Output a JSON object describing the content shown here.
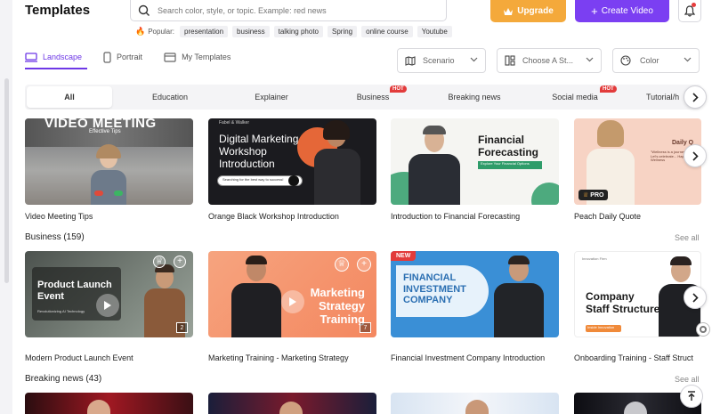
{
  "header": {
    "title": "Templates",
    "search_placeholder": "Search color, style, or topic. Example: red news",
    "popular_label": "Popular:",
    "popular_tags": [
      "presentation",
      "business",
      "talking photo",
      "Spring",
      "online course",
      "Youtube"
    ],
    "upgrade_label": "Upgrade",
    "create_label": "Create Video"
  },
  "orientation_tabs": [
    {
      "label": "Landscape",
      "icon": "monitor-icon",
      "active": true
    },
    {
      "label": "Portrait",
      "icon": "phone-icon",
      "active": false
    },
    {
      "label": "My Templates",
      "icon": "folder-icon",
      "active": false
    }
  ],
  "filters": {
    "scenario": "Scenario",
    "style": "Choose A St...",
    "color": "Color"
  },
  "categories": [
    {
      "label": "All",
      "active": true,
      "hot": false
    },
    {
      "label": "Education",
      "active": false,
      "hot": false
    },
    {
      "label": "Explainer",
      "active": false,
      "hot": false
    },
    {
      "label": "Business",
      "active": false,
      "hot": true
    },
    {
      "label": "Breaking news",
      "active": false,
      "hot": false
    },
    {
      "label": "Social media",
      "active": false,
      "hot": true
    },
    {
      "label": "Tutorial/h",
      "active": false,
      "hot": false
    }
  ],
  "hot_label": "HOT",
  "rows": [
    {
      "section": null,
      "cards": [
        {
          "title": "Video Meeting Tips",
          "thumb_text": "VIDEO MEETING",
          "thumb_sub": "Effective Tips"
        },
        {
          "title": "Orange Black Workshop Introduction",
          "thumb_text": "Digital Marketing Workshop Introduction",
          "thumb_sub": "Searching for the best way to success!",
          "thumb_top": "Fabel & Walker"
        },
        {
          "title": "Introduction to Financial Forecasting",
          "thumb_text": "Financial Forecasting",
          "thumb_sub": "Explore Your Financial Options"
        },
        {
          "title": "Peach Daily Quote",
          "thumb_text": "Daily Q",
          "thumb_sub": "\"Wellness is a journey... Let's celebrate... Happy Wellness",
          "badge": "PRO"
        }
      ]
    },
    {
      "section": "Business (159)",
      "see_all": "See all",
      "cards": [
        {
          "title": "Modern Product Launch Event",
          "thumb_text": "Product Launch Event",
          "thumb_sub": "Revolutionizing AI Technology",
          "num": "2"
        },
        {
          "title": "Marketing Training - Marketing Strategy",
          "thumb_text": "Marketing Strategy Training",
          "num": "7"
        },
        {
          "title": "Financial Investment Company Introduction",
          "thumb_text": "FINANCIAL INVESTMENT COMPANY",
          "badge": "NEW"
        },
        {
          "title": "Onboarding Training - Staff Struct",
          "thumb_text": "Company Staff Structure",
          "thumb_sub": "Inside Innovation",
          "thumb_top": "Innovation Firm"
        }
      ]
    },
    {
      "section": "Breaking news (43)",
      "see_all": "See all",
      "cards": [
        {},
        {},
        {},
        {}
      ]
    }
  ],
  "colors": {
    "accent": "#7b3ff2",
    "upgrade": "#f4a93b",
    "hot": "#e23b3b"
  }
}
